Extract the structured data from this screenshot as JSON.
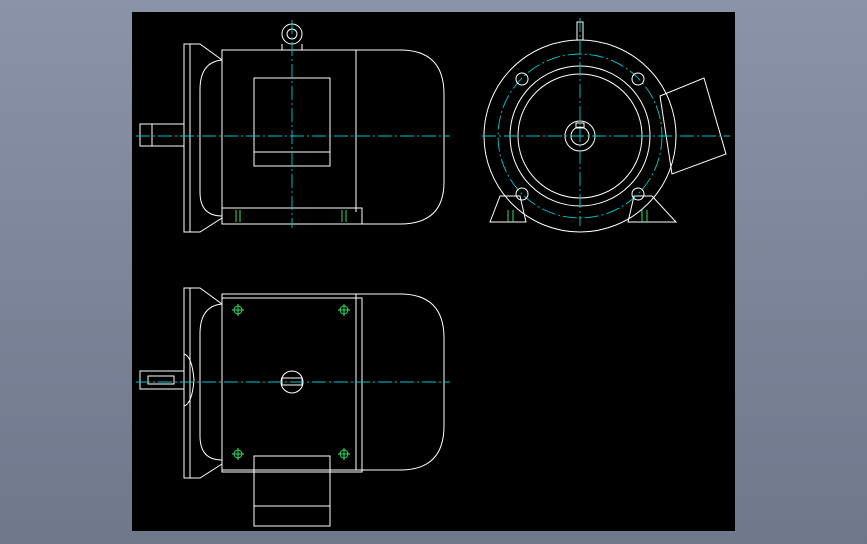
{
  "colors": {
    "canvas_background": "#000000",
    "outline": "#ffffff",
    "centerline": "#00c8d2",
    "mounting_holes": "#2ee060",
    "window_background": "#7b8599"
  },
  "views": [
    "side-view",
    "end-view",
    "top-view"
  ]
}
